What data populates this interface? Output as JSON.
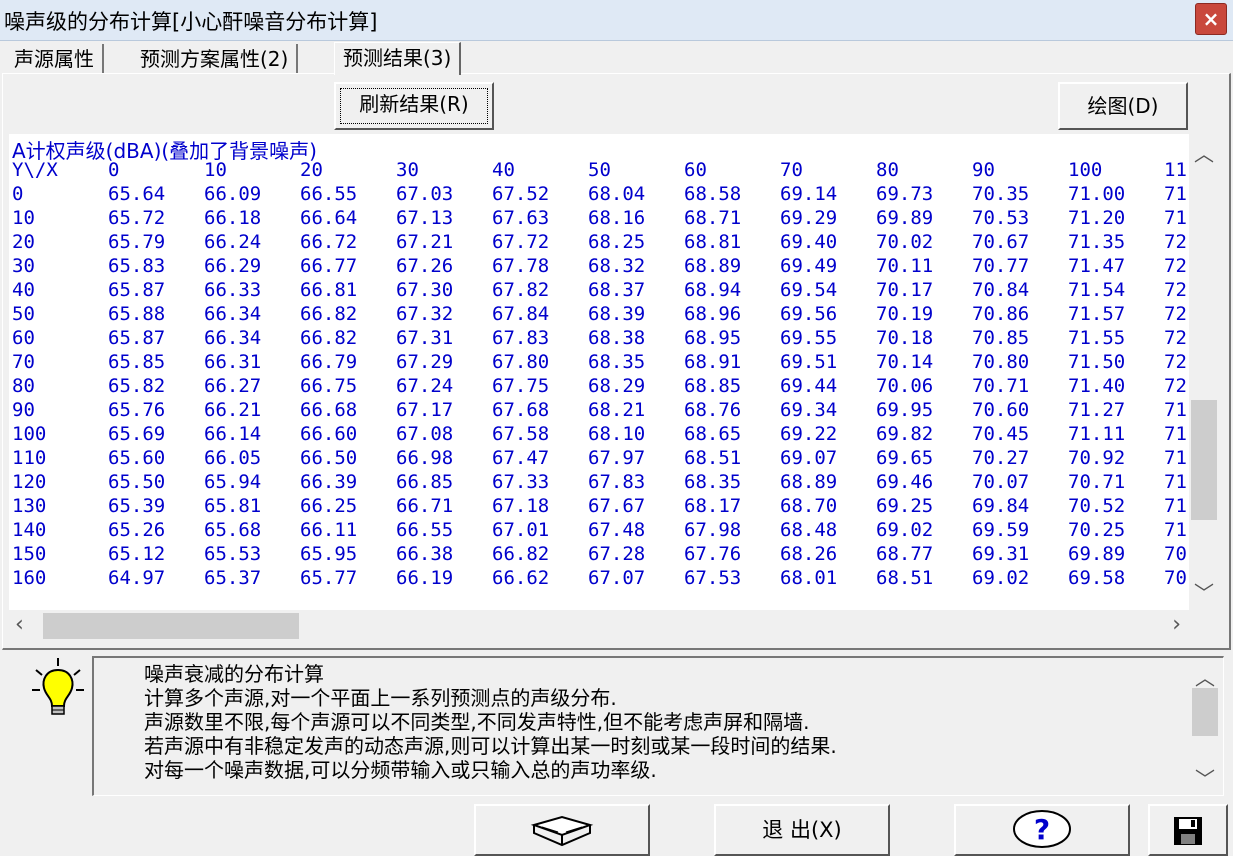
{
  "window": {
    "title": "噪声级的分布计算[小心酐噪音分布计算]",
    "close_label": "×"
  },
  "tabs": [
    "声源属性",
    "预测方案属性(2)",
    "预测结果(3)"
  ],
  "toolbar": {
    "refresh_label": "刷新结果(R)",
    "draw_label": "绘图(D)"
  },
  "grid": {
    "title": "A计权声级(dBA)(叠加了背景噪声)",
    "header": [
      "Y\\/X",
      "0",
      "10",
      "20",
      "30",
      "40",
      "50",
      "60",
      "70",
      "80",
      "90",
      "100",
      "11"
    ],
    "rows": [
      [
        "0",
        "65.64",
        "66.09",
        "66.55",
        "67.03",
        "67.52",
        "68.04",
        "68.58",
        "69.14",
        "69.73",
        "70.35",
        "71.00",
        "71"
      ],
      [
        "10",
        "65.72",
        "66.18",
        "66.64",
        "67.13",
        "67.63",
        "68.16",
        "68.71",
        "69.29",
        "69.89",
        "70.53",
        "71.20",
        "71"
      ],
      [
        "20",
        "65.79",
        "66.24",
        "66.72",
        "67.21",
        "67.72",
        "68.25",
        "68.81",
        "69.40",
        "70.02",
        "70.67",
        "71.35",
        "72"
      ],
      [
        "30",
        "65.83",
        "66.29",
        "66.77",
        "67.26",
        "67.78",
        "68.32",
        "68.89",
        "69.49",
        "70.11",
        "70.77",
        "71.47",
        "72"
      ],
      [
        "40",
        "65.87",
        "66.33",
        "66.81",
        "67.30",
        "67.82",
        "68.37",
        "68.94",
        "69.54",
        "70.17",
        "70.84",
        "71.54",
        "72"
      ],
      [
        "50",
        "65.88",
        "66.34",
        "66.82",
        "67.32",
        "67.84",
        "68.39",
        "68.96",
        "69.56",
        "70.19",
        "70.86",
        "71.57",
        "72"
      ],
      [
        "60",
        "65.87",
        "66.34",
        "66.82",
        "67.31",
        "67.83",
        "68.38",
        "68.95",
        "69.55",
        "70.18",
        "70.85",
        "71.55",
        "72"
      ],
      [
        "70",
        "65.85",
        "66.31",
        "66.79",
        "67.29",
        "67.80",
        "68.35",
        "68.91",
        "69.51",
        "70.14",
        "70.80",
        "71.50",
        "72"
      ],
      [
        "80",
        "65.82",
        "66.27",
        "66.75",
        "67.24",
        "67.75",
        "68.29",
        "68.85",
        "69.44",
        "70.06",
        "70.71",
        "71.40",
        "72"
      ],
      [
        "90",
        "65.76",
        "66.21",
        "66.68",
        "67.17",
        "67.68",
        "68.21",
        "68.76",
        "69.34",
        "69.95",
        "70.60",
        "71.27",
        "71"
      ],
      [
        "100",
        "65.69",
        "66.14",
        "66.60",
        "67.08",
        "67.58",
        "68.10",
        "68.65",
        "69.22",
        "69.82",
        "70.45",
        "71.11",
        "71"
      ],
      [
        "110",
        "65.60",
        "66.05",
        "66.50",
        "66.98",
        "67.47",
        "67.97",
        "68.51",
        "69.07",
        "69.65",
        "70.27",
        "70.92",
        "71"
      ],
      [
        "120",
        "65.50",
        "65.94",
        "66.39",
        "66.85",
        "67.33",
        "67.83",
        "68.35",
        "68.89",
        "69.46",
        "70.07",
        "70.71",
        "71"
      ],
      [
        "130",
        "65.39",
        "65.81",
        "66.25",
        "66.71",
        "67.18",
        "67.67",
        "68.17",
        "68.70",
        "69.25",
        "69.84",
        "70.52",
        "71"
      ],
      [
        "140",
        "65.26",
        "65.68",
        "66.11",
        "66.55",
        "67.01",
        "67.48",
        "67.98",
        "68.48",
        "69.02",
        "69.59",
        "70.25",
        "71"
      ],
      [
        "150",
        "65.12",
        "65.53",
        "65.95",
        "66.38",
        "66.82",
        "67.28",
        "67.76",
        "68.26",
        "68.77",
        "69.31",
        "69.89",
        "70"
      ],
      [
        "160",
        "64.97",
        "65.37",
        "65.77",
        "66.19",
        "66.62",
        "67.07",
        "67.53",
        "68.01",
        "68.51",
        "69.02",
        "69.58",
        "70"
      ]
    ]
  },
  "info": {
    "lines": [
      "噪声衰减的分布计算",
      "计算多个声源,对一个平面上一系列预测点的声级分布.",
      "声源数里不限,每个声源可以不同类型,不同发声特性,但不能考虑声屏和隔墙.",
      "若声源中有非稳定发声的动态声源,则可以计算出某一时刻或某一段时间的结果.",
      "对每一个噪声数据,可以分频带输入或只输入总的声功率级."
    ]
  },
  "bottom": {
    "exit_label": "退 出(X)"
  },
  "colors": {
    "grid_text": "#0000cc",
    "titlebar_bg": "#dfe9f5",
    "close_bg": "#c9483c"
  },
  "icons": {
    "bulb": "lightbulb-icon",
    "book": "book-icon",
    "help": "help-icon",
    "save": "save-icon"
  }
}
